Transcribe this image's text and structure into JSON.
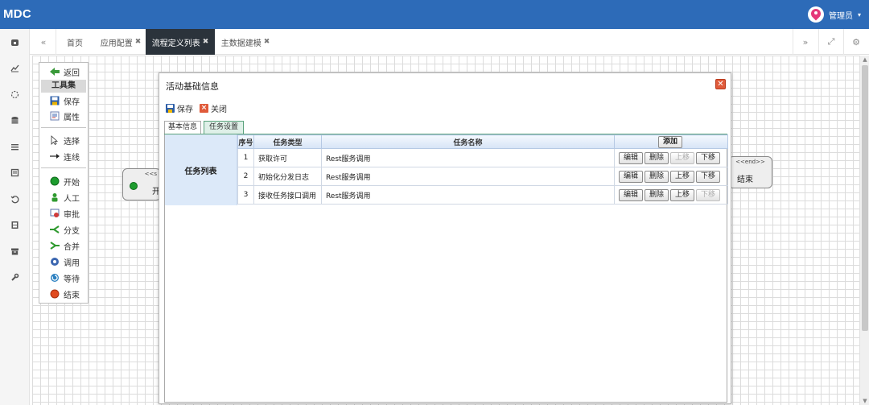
{
  "app": {
    "brand": "MDC",
    "user_name": "管理员",
    "user_caret": "▾"
  },
  "sidebar": {
    "icons": [
      "home-icon",
      "chart-icon",
      "spinner-icon",
      "database-icon",
      "list-icon",
      "document-icon",
      "history-icon",
      "film-icon",
      "archive-icon",
      "wrench-icon"
    ]
  },
  "tabs": {
    "left_nav_glyph": "«",
    "items": [
      {
        "label": "首页",
        "closable": false
      },
      {
        "label": "应用配置",
        "closable": true
      },
      {
        "label": "流程定义列表",
        "closable": true,
        "active": true
      },
      {
        "label": "主数据建模",
        "closable": true
      }
    ],
    "close_glyph": "✖",
    "right_nav_glyph": "»",
    "fullscreen_glyph": "⤢",
    "settings_glyph": "⚙"
  },
  "palette": {
    "back": "返回",
    "header": "工具集",
    "save": "保存",
    "props": "属性",
    "select": "选择",
    "connect": "连线",
    "nodes": [
      "开始",
      "人工",
      "审批",
      "分支",
      "合并",
      "调用",
      "等待",
      "结束"
    ]
  },
  "canvas_nodes": {
    "start": {
      "stereo": "<<s",
      "label": "开"
    },
    "end": {
      "stereo": "<<end>>",
      "label": "结束"
    }
  },
  "dialog": {
    "title": "活动基础信息",
    "close_glyph": "✕",
    "toolbar": {
      "save": "保存",
      "close": "关闭"
    },
    "tabs": [
      "基本信息",
      "任务设置"
    ],
    "grid_label": "任务列表",
    "columns": {
      "index": "序号",
      "type": "任务类型",
      "name": "任务名称",
      "add": "添加"
    },
    "rows": [
      {
        "index": "1",
        "type": "获取许可",
        "name": "Rest服务调用"
      },
      {
        "index": "2",
        "type": "初始化分发日志",
        "name": "Rest服务调用"
      },
      {
        "index": "3",
        "type": "接收任务接口调用",
        "name": "Rest服务调用"
      }
    ],
    "row_buttons": {
      "edit": "编辑",
      "delete": "删除",
      "up": "上移",
      "down": "下移"
    }
  },
  "colors": {
    "topbar": "#2d6bb8",
    "active_tab": "#2b333b",
    "dialog_tab_selected": "#dff0e8",
    "grid_label_bg": "#dce9f9"
  }
}
